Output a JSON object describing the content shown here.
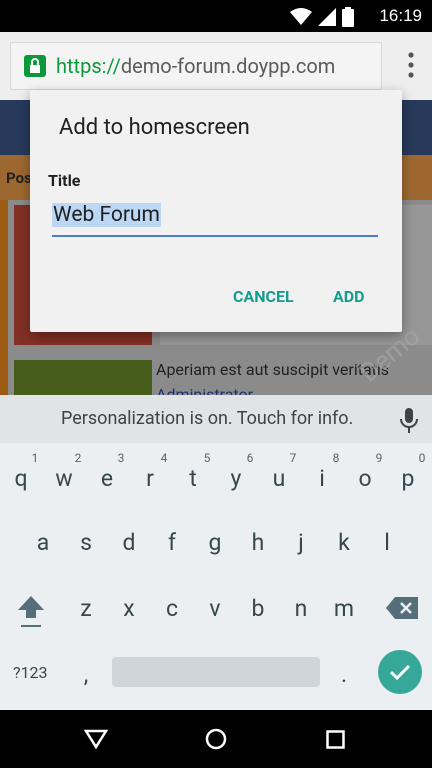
{
  "status": {
    "time": "16:19"
  },
  "browser": {
    "url_scheme": "https://",
    "url_host": "demo-forum.doypp.com"
  },
  "page_bg": {
    "post_text": "Aperiam est aut suscipit veritatis",
    "author": "Administrator",
    "partial_tab": "Pos",
    "watermark": "Demo"
  },
  "dialog": {
    "title": "Add to homescreen",
    "label": "Title",
    "input_value": "Web Forum",
    "cancel_label": "CANCEL",
    "add_label": "ADD"
  },
  "keyboard": {
    "suggestion": "Personalization is on. Touch for info.",
    "row1": [
      "q",
      "w",
      "e",
      "r",
      "t",
      "y",
      "u",
      "i",
      "o",
      "p"
    ],
    "hints": [
      "1",
      "2",
      "3",
      "4",
      "5",
      "6",
      "7",
      "8",
      "9",
      "0"
    ],
    "row2": [
      "a",
      "s",
      "d",
      "f",
      "g",
      "h",
      "j",
      "k",
      "l"
    ],
    "row3": [
      "z",
      "x",
      "c",
      "v",
      "b",
      "n",
      "m"
    ],
    "symbols_label": "?123",
    "comma": ",",
    "period": "."
  },
  "colors": {
    "accent": "#129e8e",
    "secure": "#0a9a3b",
    "input_line": "#4a7cd0"
  }
}
